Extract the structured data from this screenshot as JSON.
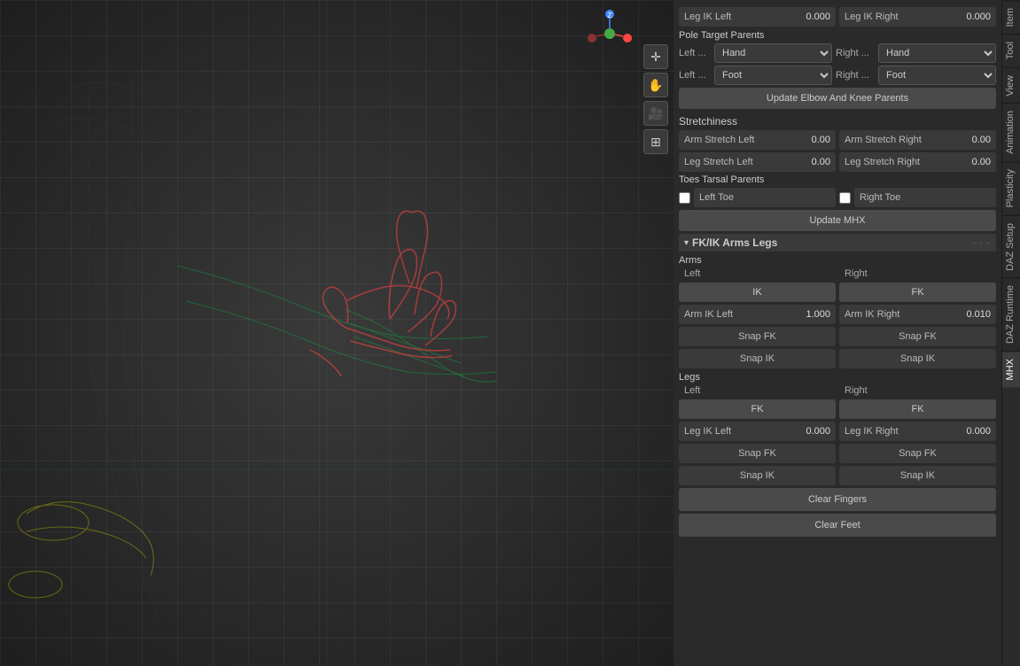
{
  "viewport": {
    "toolbar": {
      "tools": [
        {
          "name": "plus-icon",
          "symbol": "✛"
        },
        {
          "name": "hand-icon",
          "symbol": "✋"
        },
        {
          "name": "camera-icon",
          "symbol": "🎥"
        },
        {
          "name": "grid-icon",
          "symbol": "⊞"
        }
      ]
    }
  },
  "side_tabs": [
    {
      "id": "item",
      "label": "Item"
    },
    {
      "id": "tool",
      "label": "Tool"
    },
    {
      "id": "view",
      "label": "View"
    },
    {
      "id": "animation",
      "label": "Animation"
    },
    {
      "id": "plasticity",
      "label": "Plasticity"
    },
    {
      "id": "daz-setup",
      "label": "DAZ Setup"
    },
    {
      "id": "daz-runtime",
      "label": "DAZ Runtime"
    },
    {
      "id": "mhx",
      "label": "MHX"
    }
  ],
  "panel": {
    "top_row": {
      "leg_ik_left_label": "Leg IK Left",
      "leg_ik_left_value": "0.000",
      "leg_ik_right_label": "Leg IK Right",
      "leg_ik_right_value": "0.000"
    },
    "pole_target": {
      "section_label": "Pole Target Parents",
      "left_hand_label": "Left ...",
      "left_hand_value": "Hand",
      "right_hand_label": "Right ...",
      "right_hand_value": "Hand",
      "left_foot_label": "Left ...",
      "left_foot_value": "Foot",
      "right_foot_label": "Right ...",
      "right_foot_value": "Foot",
      "update_btn": "Update Elbow And Knee Parents"
    },
    "stretchiness": {
      "section_label": "Stretchiness",
      "arm_stretch_left_label": "Arm Stretch Left",
      "arm_stretch_left_value": "0.00",
      "arm_stretch_right_label": "Arm Stretch Right",
      "arm_stretch_right_value": "0.00",
      "leg_stretch_left_label": "Leg Stretch Left",
      "leg_stretch_left_value": "0.00",
      "leg_stretch_right_label": "Leg Stretch Right",
      "leg_stretch_right_value": "0.00"
    },
    "toes_tarsal": {
      "section_label": "Toes Tarsal Parents",
      "left_toe_label": "Left Toe",
      "right_toe_label": "Right Toe",
      "update_mhx_btn": "Update MHX"
    },
    "fkik": {
      "section_label": "FK/IK Arms Legs",
      "arms_label": "Arms",
      "arms_left_label": "Left",
      "arms_right_label": "Right",
      "arm_left_mode_btn": "IK",
      "arm_right_mode_btn": "FK",
      "arm_ik_left_label": "Arm IK Left",
      "arm_ik_left_value": "1.000",
      "arm_ik_right_label": "Arm IK Right",
      "arm_ik_right_value": "0.010",
      "arm_snap_fk_left": "Snap FK",
      "arm_snap_fk_right": "Snap FK",
      "arm_snap_ik_left": "Snap IK",
      "arm_snap_ik_right": "Snap IK",
      "legs_label": "Legs",
      "legs_left_label": "Left",
      "legs_right_label": "Right",
      "leg_left_mode_btn": "FK",
      "leg_right_mode_btn": "FK",
      "leg_ik_left_label": "Leg IK Left",
      "leg_ik_left_value": "0.000",
      "leg_ik_right_label": "Leg IK Right",
      "leg_ik_right_value": "0.000",
      "leg_snap_fk_left": "Snap FK",
      "leg_snap_fk_right": "Snap FK",
      "leg_snap_ik_left": "Snap IK",
      "leg_snap_ik_right": "Snap IK",
      "clear_fingers_btn": "Clear Fingers",
      "clear_feet_btn": "Clear Feet"
    }
  }
}
